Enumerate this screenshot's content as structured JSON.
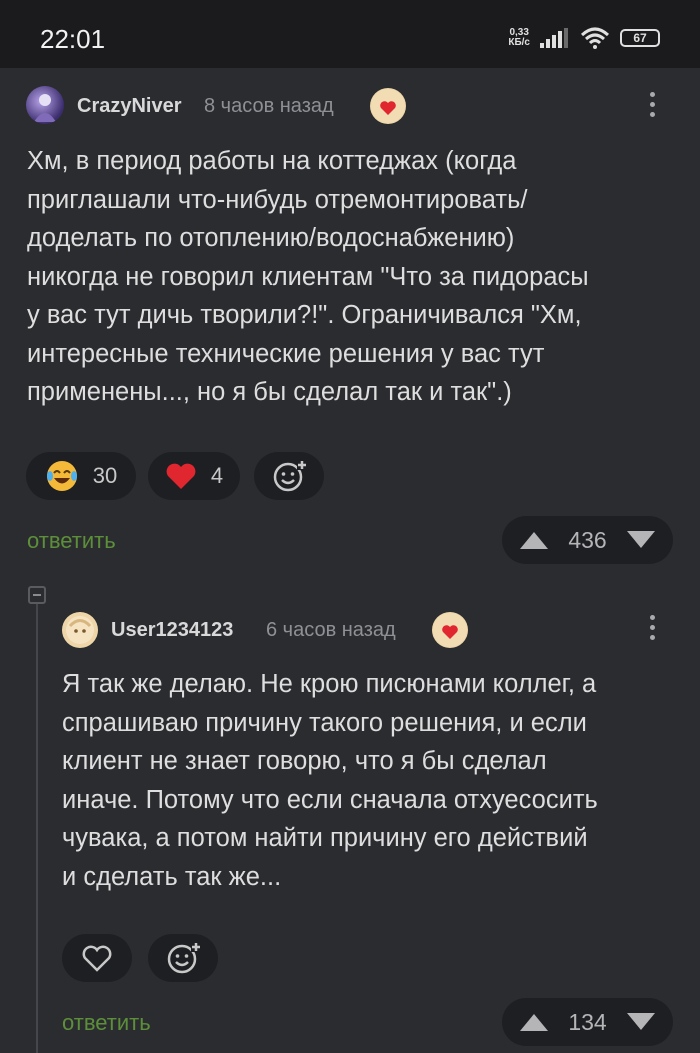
{
  "status_bar": {
    "time": "22:01",
    "net_speed_value": "0,33",
    "net_speed_unit": "КБ/с",
    "battery": "67"
  },
  "comments": [
    {
      "author": "CrazyNiver",
      "time_ago": "8 часов назад",
      "text": "Хм, в период работы на коттеджах (когда\nприглашали что-нибудь отремонтировать/\nдоделать по отоплению/водоснабжению)\nникогда не говорил клиентам \"Что за пидорасы\nу вас тут дичь творили?!\". Ограничивался \"Хм,\nинтересные технические решения у вас тут\nприменены..., но я бы сделал так и так\".)",
      "reactions": [
        {
          "icon": "laughing-emoji-icon",
          "count": "30"
        },
        {
          "icon": "heart-icon",
          "count": "4"
        }
      ],
      "reply_label": "ответить",
      "rating": "436"
    },
    {
      "author": "User1234123",
      "time_ago": "6 часов назад",
      "text": "Я так же делаю. Не крою писюнами коллег, а\nспрашиваю причину такого решения, и если\nклиент не знает говорю, что я бы сделал\nиначе. Потому что если сначала отхуесосить\nчувака, а потом найти причину его действий\nи сделать так же...",
      "reply_label": "ответить",
      "rating": "134"
    }
  ],
  "colors": {
    "background": "#2b2c30",
    "pill": "#1e1f22",
    "reply_green": "#5d8f3a",
    "heart_red": "#e0262f"
  }
}
